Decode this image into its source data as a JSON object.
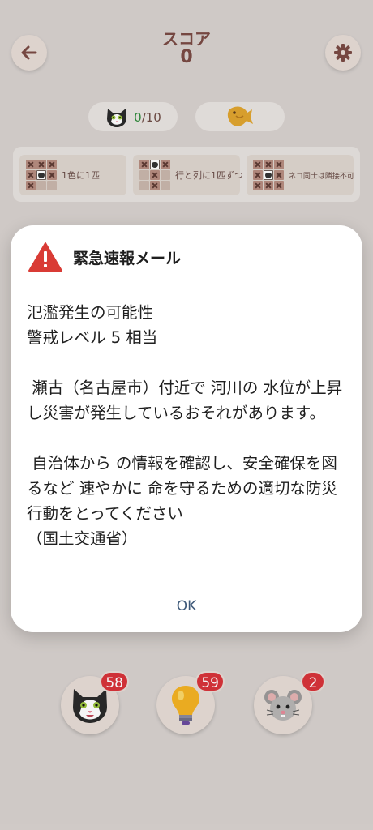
{
  "header": {
    "title": "スコア",
    "score": "0"
  },
  "icons": {
    "back": "arrow-left-icon",
    "settings": "gear-icon"
  },
  "counter": {
    "done": "0",
    "separator": "/",
    "total": "10"
  },
  "rules": [
    {
      "label": "1色に1匹"
    },
    {
      "label": "行と列に1匹ずつ"
    },
    {
      "label": "ネコ同士は隣接不可"
    }
  ],
  "powerups": [
    {
      "name": "cat",
      "count": "58"
    },
    {
      "name": "hint-bulb",
      "count": "59"
    },
    {
      "name": "mouse",
      "count": "2"
    }
  ],
  "alert": {
    "title": "緊急速報メール",
    "paragraphs": [
      "氾濫発生の可能性\n警戒レベル 5 相当",
      " 瀬古（名古屋市）付近で 河川の 水位が上昇し災害が発生しているおそれがあります。",
      " 自治体から の情報を確認し、安全確保を図るなど 速やかに 命を守るための適切な防災行動をとってください\n（国土交通省）"
    ],
    "ok_label": "OK"
  },
  "colors": {
    "accent": "#7a4a44",
    "badge": "#d8333a",
    "warning": "#d93b35",
    "ok": "#3f5a7a"
  }
}
